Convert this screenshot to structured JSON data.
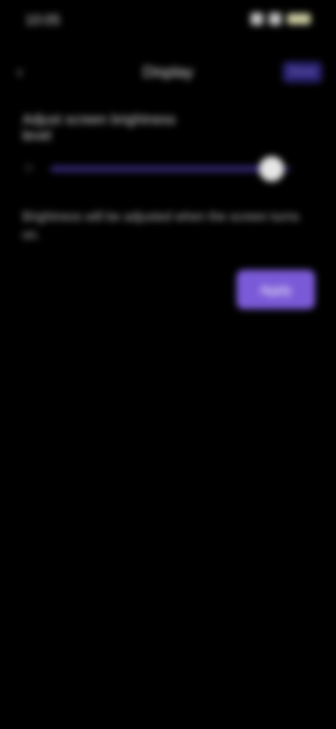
{
  "status_bar": {
    "time": "10:05",
    "icons": [
      "signal-icon",
      "wifi-icon",
      "battery-icon"
    ]
  },
  "app_bar": {
    "back_icon": "arrow-left-icon",
    "title": "Display",
    "action_label": "Done"
  },
  "setting": {
    "label": "Adjust screen brightness level",
    "slider_icon": "brightness-low-icon",
    "slider_value_percent": 92
  },
  "description": "Brightness will be adjusted when the screen turns on.",
  "button": {
    "label": "Apply"
  },
  "colors": {
    "background": "#000000",
    "accent": "#7b5ad8",
    "slider_track": "#241a48"
  }
}
